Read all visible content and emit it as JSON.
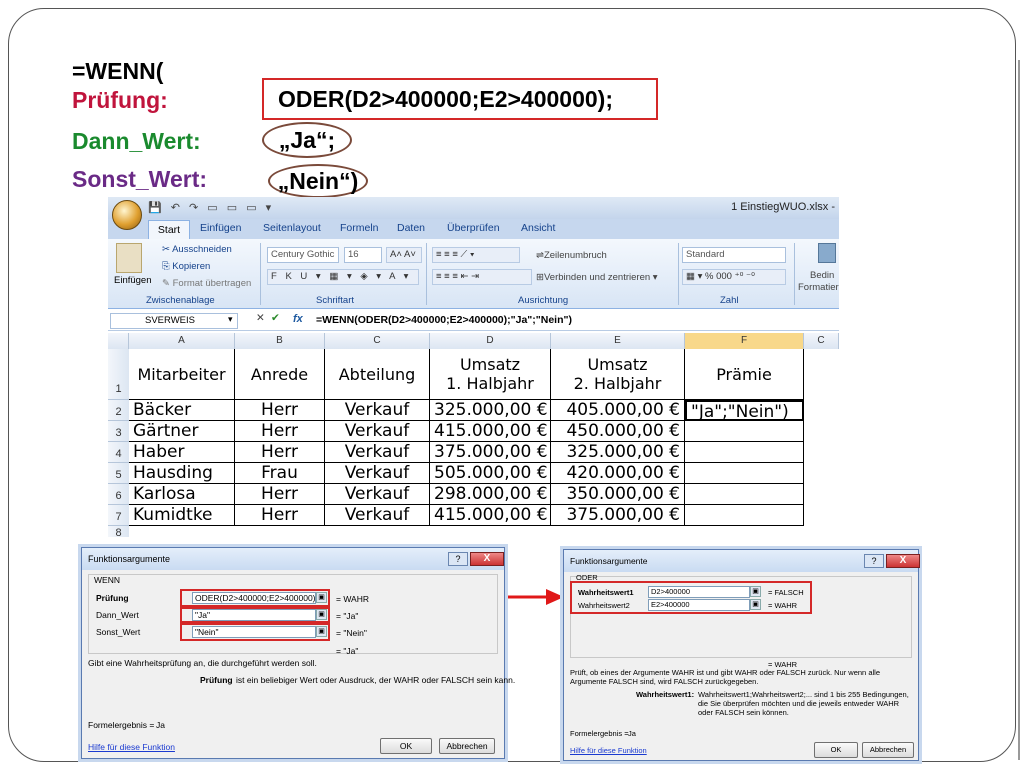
{
  "slide": {
    "line1": "=WENN(",
    "pruefung_label": "Prüfung:",
    "pruefung_value": "ODER(D2>400000;E2>400000);",
    "dann_label": "Dann_Wert:",
    "dann_value": "„Ja“;",
    "sonst_label": "Sonst_Wert:",
    "sonst_value": "„Nein“)",
    "colors": {
      "red": "#c0143c",
      "green": "#1a8a2e",
      "purple": "#6a2a86",
      "box": "#d42828"
    }
  },
  "excel": {
    "doc_title": "1 EinstiegWUO.xlsx -",
    "tabs": [
      "Start",
      "Einfügen",
      "Seitenlayout",
      "Formeln",
      "Daten",
      "Überprüfen",
      "Ansicht"
    ],
    "ribbon": {
      "cut": "Ausschneiden",
      "copy": "Kopieren",
      "paste": "Einfügen",
      "format_painter": "Format übertragen",
      "clipboard_group": "Zwischenablage",
      "font_name": "Century Gothic",
      "font_size": "16",
      "font_group": "Schriftart",
      "wrap": "Zeilenumbruch",
      "merge": "Verbinden und zentrieren",
      "align_group": "Ausrichtung",
      "number_format": "Standard",
      "number_group": "Zahl",
      "cond1": "Bedin",
      "cond2": "Formatier"
    },
    "name_box": "SVERWEIS",
    "fx": "fx",
    "formula": "=WENN(ODER(D2>400000;E2>400000);\"Ja\";\"Nein\")",
    "columns": [
      "A",
      "B",
      "C",
      "D",
      "E",
      "F",
      "C"
    ],
    "header": [
      "Mitarbeiter",
      "Anrede",
      "Abteilung",
      "Umsatz",
      "1. Halbjahr",
      "Umsatz",
      "2. Halbjahr",
      "Prämie"
    ],
    "row_numbers": [
      "1",
      "2",
      "3",
      "4",
      "5",
      "6",
      "7",
      "8"
    ],
    "rows": [
      [
        "Bäcker",
        "Herr",
        "Verkauf",
        "325.000,00 €",
        "405.000,00 €",
        "\"Ja\";\"Nein\")"
      ],
      [
        "Gärtner",
        "Herr",
        "Verkauf",
        "415.000,00 €",
        "450.000,00 €",
        ""
      ],
      [
        "Haber",
        "Herr",
        "Verkauf",
        "375.000,00 €",
        "325.000,00 €",
        ""
      ],
      [
        "Hausding",
        "Frau",
        "Verkauf",
        "505.000,00 €",
        "420.000,00 €",
        ""
      ],
      [
        "Karlosa",
        "Herr",
        "Verkauf",
        "298.000,00 €",
        "350.000,00 €",
        ""
      ],
      [
        "Kumidtke",
        "Herr",
        "Verkauf",
        "415.000,00 €",
        "375.000,00 €",
        ""
      ]
    ]
  },
  "dialog1": {
    "title": "Funktionsargumente",
    "func": "WENN",
    "args": [
      {
        "label": "Prüfung",
        "value": "ODER(D2>400000;E2>400000)",
        "result": "= WAHR"
      },
      {
        "label": "Dann_Wert",
        "value": "\"Ja\"",
        "result": "= \"Ja\""
      },
      {
        "label": "Sonst_Wert",
        "value": "\"Nein\"",
        "result": "= \"Nein\""
      }
    ],
    "overall": "= \"Ja\"",
    "desc": "Gibt eine Wahrheitsprüfung an, die durchgeführt werden soll.",
    "arg_desc_label": "Prüfung",
    "arg_desc": "ist ein beliebiger Wert oder Ausdruck, der WAHR oder FALSCH sein kann.",
    "result_label": "Formelergebnis =",
    "result_value": "Ja",
    "help": "Hilfe für diese Funktion",
    "ok": "OK",
    "cancel": "Abbrechen",
    "help_btn": "?",
    "close_btn": "X"
  },
  "dialog2": {
    "title": "Funktionsargumente",
    "func": "ODER",
    "args": [
      {
        "label": "Wahrheitswert1",
        "value": "D2>400000",
        "result": "= FALSCH"
      },
      {
        "label": "Wahrheitswert2",
        "value": "E2>400000",
        "result": "= WAHR"
      }
    ],
    "overall": "= WAHR",
    "desc": "Prüft, ob eines der Argumente WAHR ist und gibt WAHR oder FALSCH zurück. Nur wenn alle Argumente FALSCH sind, wird FALSCH zurückgegeben.",
    "arg_desc_label": "Wahrheitswert1:",
    "arg_desc": "Wahrheitswert1;Wahrheitswert2;... sind 1 bis 255 Bedingungen, die Sie überprüfen möchten und die jeweils entweder WAHR oder FALSCH sein können.",
    "result_label": "Formelergebnis =",
    "result_value": "Ja",
    "help": "Hilfe für diese Funktion",
    "ok": "OK",
    "cancel": "Abbrechen",
    "help_btn": "?",
    "close_btn": "X"
  }
}
